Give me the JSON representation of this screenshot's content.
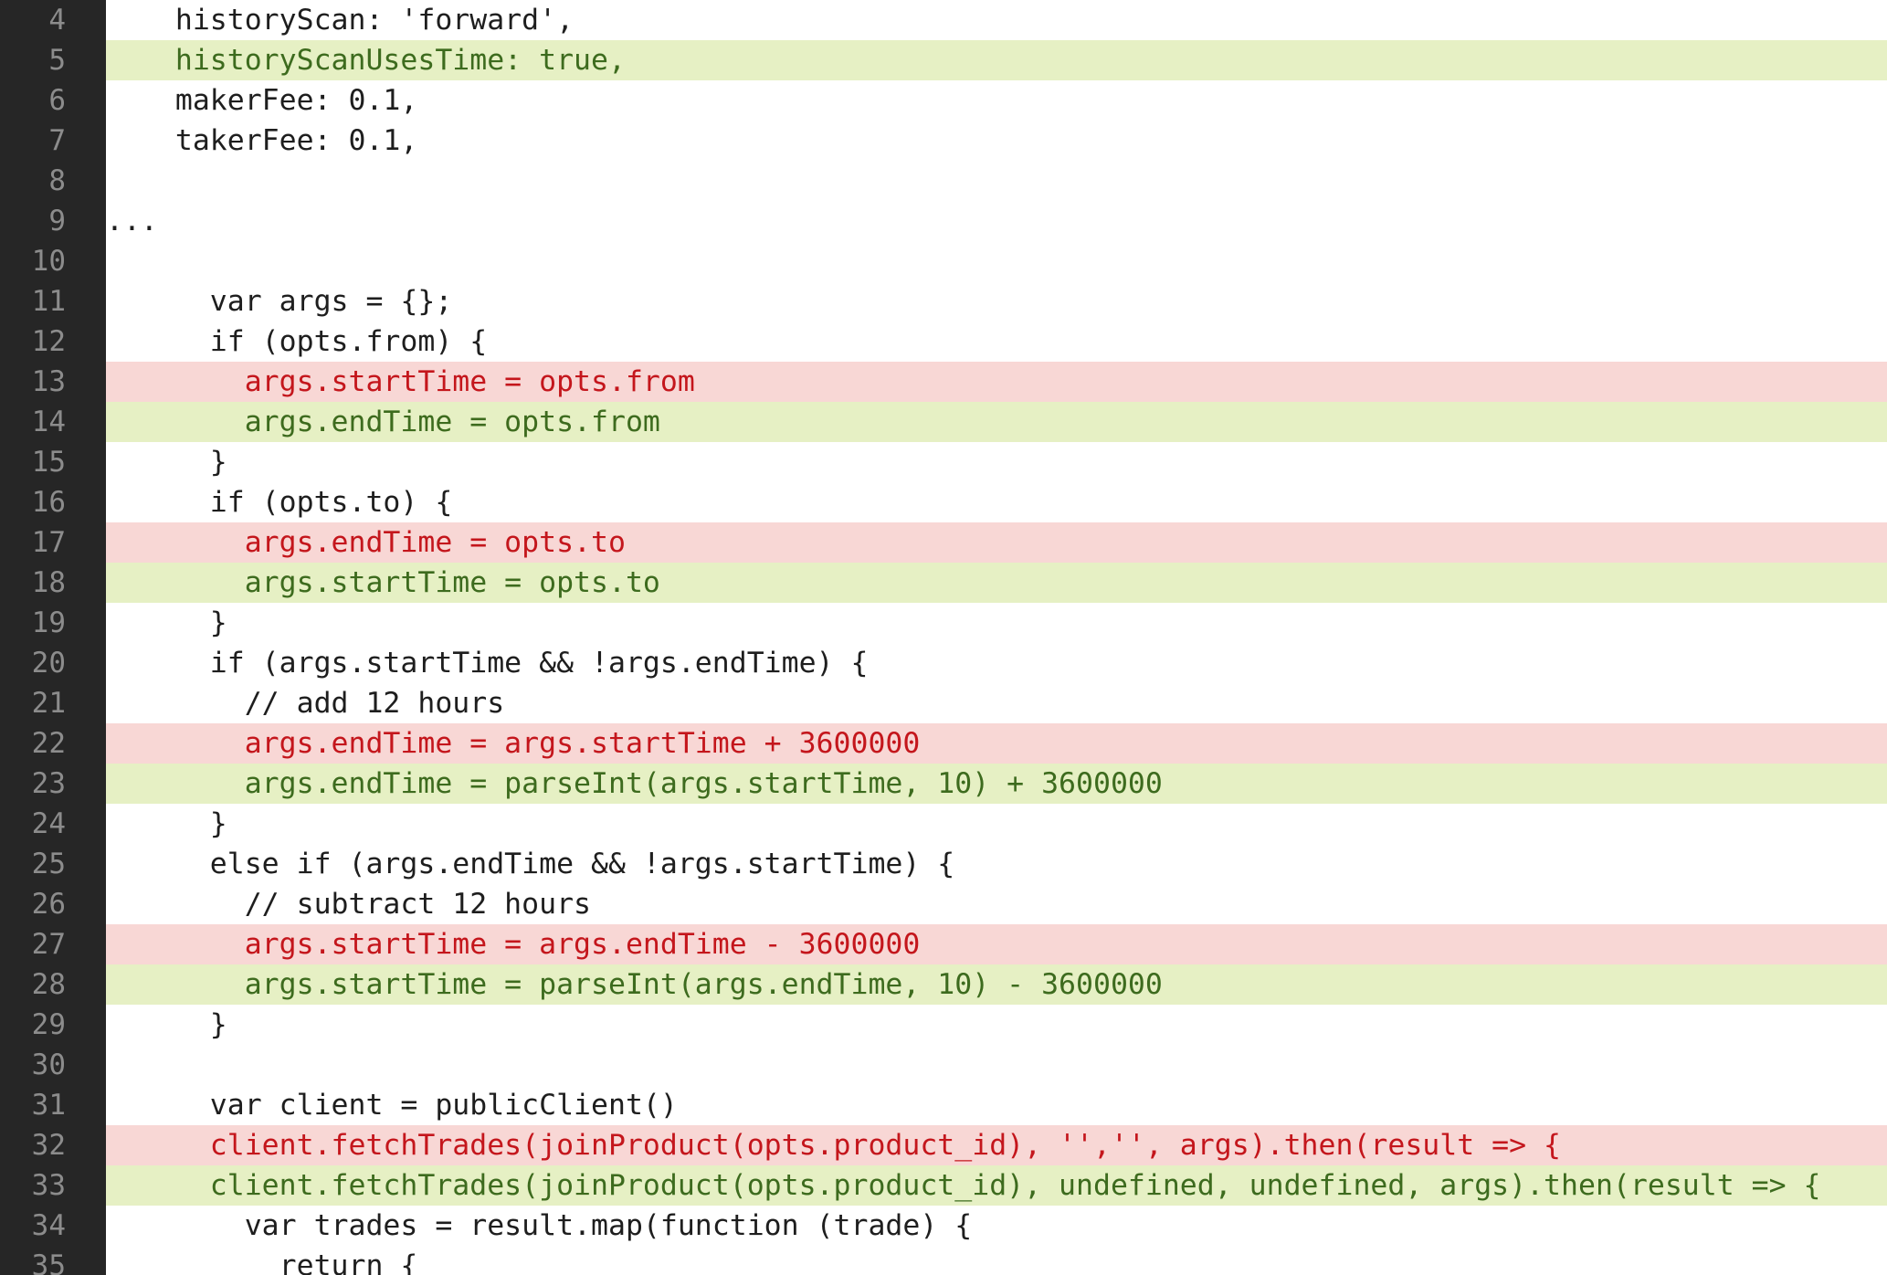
{
  "editor": {
    "lines": [
      {
        "number": "4",
        "text": "    historyScan: 'forward',",
        "state": "normal"
      },
      {
        "number": "5",
        "text": "    historyScanUsesTime: true,",
        "state": "added"
      },
      {
        "number": "6",
        "text": "    makerFee: 0.1,",
        "state": "normal"
      },
      {
        "number": "7",
        "text": "    takerFee: 0.1,",
        "state": "normal"
      },
      {
        "number": "8",
        "text": "",
        "state": "normal"
      },
      {
        "number": "9",
        "text": "...",
        "state": "normal"
      },
      {
        "number": "10",
        "text": "",
        "state": "normal"
      },
      {
        "number": "11",
        "text": "      var args = {};",
        "state": "normal"
      },
      {
        "number": "12",
        "text": "      if (opts.from) {",
        "state": "normal"
      },
      {
        "number": "13",
        "text": "        args.startTime = opts.from",
        "state": "removed"
      },
      {
        "number": "14",
        "text": "        args.endTime = opts.from",
        "state": "added"
      },
      {
        "number": "15",
        "text": "      }",
        "state": "normal"
      },
      {
        "number": "16",
        "text": "      if (opts.to) {",
        "state": "normal"
      },
      {
        "number": "17",
        "text": "        args.endTime = opts.to",
        "state": "removed"
      },
      {
        "number": "18",
        "text": "        args.startTime = opts.to",
        "state": "added"
      },
      {
        "number": "19",
        "text": "      }",
        "state": "normal"
      },
      {
        "number": "20",
        "text": "      if (args.startTime && !args.endTime) {",
        "state": "normal"
      },
      {
        "number": "21",
        "text": "        // add 12 hours",
        "state": "normal"
      },
      {
        "number": "22",
        "text": "        args.endTime = args.startTime + 3600000",
        "state": "removed"
      },
      {
        "number": "23",
        "text": "        args.endTime = parseInt(args.startTime, 10) + 3600000",
        "state": "added"
      },
      {
        "number": "24",
        "text": "      }",
        "state": "normal"
      },
      {
        "number": "25",
        "text": "      else if (args.endTime && !args.startTime) {",
        "state": "normal"
      },
      {
        "number": "26",
        "text": "        // subtract 12 hours",
        "state": "normal"
      },
      {
        "number": "27",
        "text": "        args.startTime = args.endTime - 3600000",
        "state": "removed"
      },
      {
        "number": "28",
        "text": "        args.startTime = parseInt(args.endTime, 10) - 3600000",
        "state": "added"
      },
      {
        "number": "29",
        "text": "      }",
        "state": "normal"
      },
      {
        "number": "30",
        "text": "",
        "state": "normal"
      },
      {
        "number": "31",
        "text": "      var client = publicClient()",
        "state": "normal"
      },
      {
        "number": "32",
        "text": "      client.fetchTrades(joinProduct(opts.product_id), '','', args).then(result => {",
        "state": "removed"
      },
      {
        "number": "33",
        "text": "      client.fetchTrades(joinProduct(opts.product_id), undefined, undefined, args).then(result => {",
        "state": "added"
      },
      {
        "number": "34",
        "text": "        var trades = result.map(function (trade) {",
        "state": "normal"
      },
      {
        "number": "35",
        "text": "          return {",
        "state": "normal"
      }
    ]
  }
}
